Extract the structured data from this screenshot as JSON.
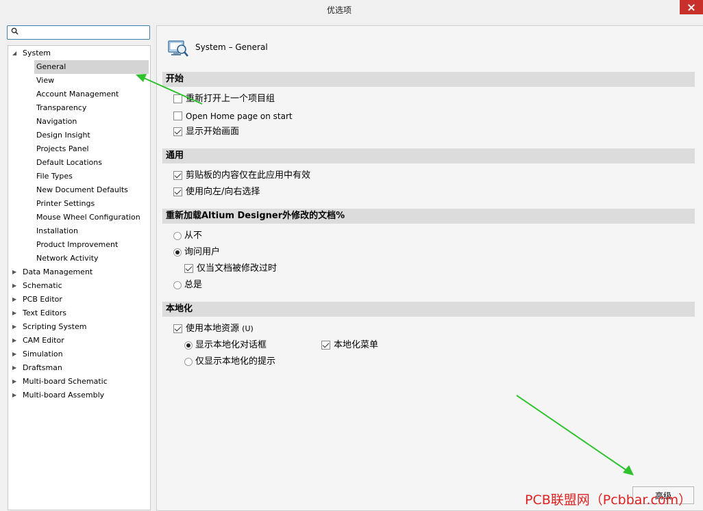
{
  "window": {
    "title": "优选项"
  },
  "search": {
    "placeholder": ""
  },
  "tree": {
    "system_label": "System",
    "system_children": [
      "General",
      "View",
      "Account Management",
      "Transparency",
      "Navigation",
      "Design Insight",
      "Projects Panel",
      "Default Locations",
      "File Types",
      "New Document Defaults",
      "Printer Settings",
      "Mouse Wheel Configuration",
      "Installation",
      "Product Improvement",
      "Network Activity"
    ],
    "collapsed": [
      "Data Management",
      "Schematic",
      "PCB Editor",
      "Text Editors",
      "Scripting System",
      "CAM Editor",
      "Simulation",
      "Draftsman",
      "Multi-board Schematic",
      "Multi-board Assembly"
    ]
  },
  "main": {
    "header_title": "System – General",
    "sections": {
      "start": "开始",
      "general": "通用",
      "reload": "重新加载Altium Designer外修改的文档%",
      "localization": "本地化"
    },
    "start_options": [
      {
        "label": "重新打开上一个项目组",
        "checked": false
      },
      {
        "label": "Open Home page on start",
        "checked": false
      },
      {
        "label": "显示开始画面",
        "checked": true
      }
    ],
    "general_options": [
      {
        "label": "剪贴板的内容仅在此应用中有效",
        "checked": true
      },
      {
        "label": "使用向左/向右选择",
        "checked": true
      }
    ],
    "reload_options": {
      "never": "从不",
      "ask": "询问用户",
      "only_modified": "仅当文档被修改过时",
      "always": "总是"
    },
    "localization_options": {
      "use_local": "使用本地资源",
      "use_local_accel": "(U)",
      "show_dialog": "显示本地化对话框",
      "local_menu": "本地化菜单",
      "only_hints": "仅显示本地化的提示"
    }
  },
  "footer": {
    "advanced_button": "高级"
  },
  "watermark": "PCB联盟网（Pcbbar.com）",
  "colors": {
    "selection": "#d4d4d4",
    "arrow": "#2ec22e",
    "close": "#c7302b",
    "watermark": "#e02020"
  }
}
